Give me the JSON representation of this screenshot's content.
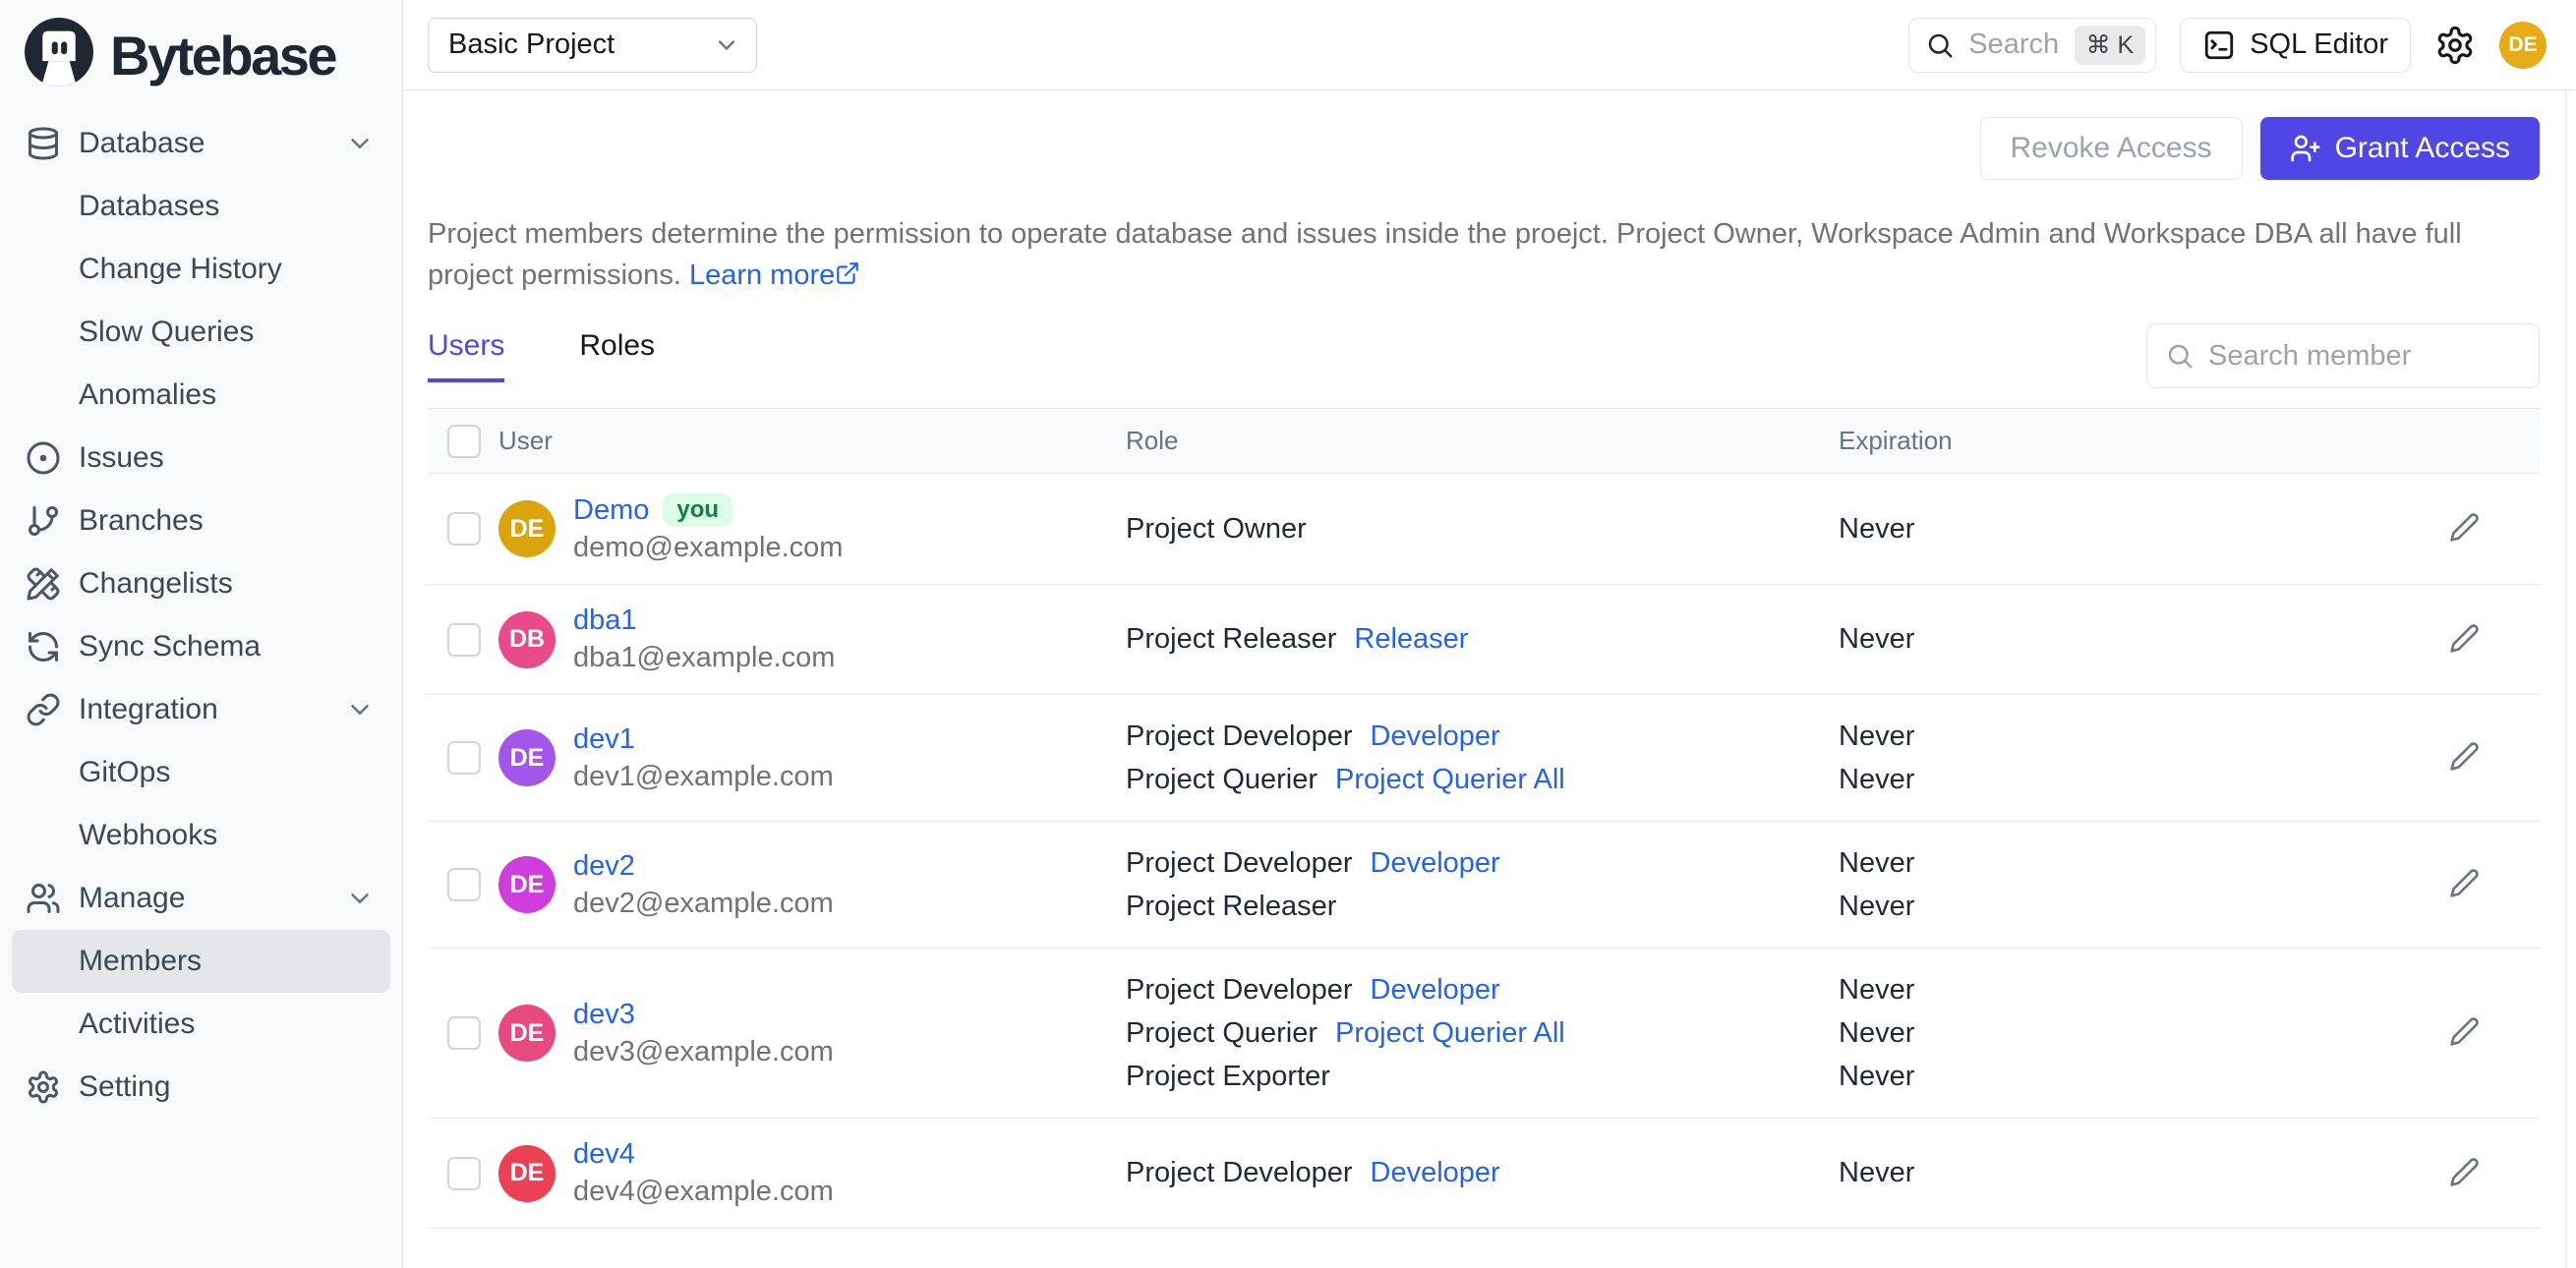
{
  "brand": {
    "name": "Bytebase"
  },
  "topbar": {
    "project_selector": {
      "value": "Basic Project"
    },
    "search": {
      "placeholder": "Search",
      "shortcut": "⌘ K"
    },
    "sql_editor": {
      "label": "SQL Editor"
    },
    "avatar": {
      "initials": "DE",
      "color": "#e7ab18"
    }
  },
  "sidebar": {
    "items": [
      {
        "label": "Database",
        "icon": "database",
        "kind": "group",
        "chevron": true
      },
      {
        "label": "Databases",
        "kind": "sub"
      },
      {
        "label": "Change History",
        "kind": "sub"
      },
      {
        "label": "Slow Queries",
        "kind": "sub"
      },
      {
        "label": "Anomalies",
        "kind": "sub"
      },
      {
        "label": "Issues",
        "icon": "issues",
        "kind": "group"
      },
      {
        "label": "Branches",
        "icon": "branch",
        "kind": "group"
      },
      {
        "label": "Changelists",
        "icon": "changelist",
        "kind": "group"
      },
      {
        "label": "Sync Schema",
        "icon": "sync",
        "kind": "group"
      },
      {
        "label": "Integration",
        "icon": "link",
        "kind": "group",
        "chevron": true
      },
      {
        "label": "GitOps",
        "kind": "sub"
      },
      {
        "label": "Webhooks",
        "kind": "sub"
      },
      {
        "label": "Manage",
        "icon": "users",
        "kind": "group",
        "chevron": true
      },
      {
        "label": "Members",
        "kind": "sub",
        "active": true
      },
      {
        "label": "Activities",
        "kind": "sub"
      },
      {
        "label": "Setting",
        "icon": "gear",
        "kind": "group"
      }
    ]
  },
  "page": {
    "actions": {
      "revoke_label": "Revoke Access",
      "grant_label": "Grant Access"
    },
    "description": {
      "text": "Project members determine the permission to operate database and issues inside the proejct. Project Owner, Workspace Admin and Workspace DBA all have full project permissions.",
      "learn_more": "Learn more"
    },
    "tabs": [
      {
        "label": "Users",
        "active": true
      },
      {
        "label": "Roles",
        "active": false
      }
    ],
    "member_search": {
      "placeholder": "Search member"
    }
  },
  "members_table": {
    "columns": {
      "user": "User",
      "role": "Role",
      "expiration": "Expiration"
    },
    "rows": [
      {
        "initials": "DE",
        "color": "#d9a40e",
        "name": "Demo",
        "badge": "you",
        "email": "demo@example.com",
        "roles": [
          {
            "name": "Project Owner",
            "link": "",
            "expiration": "Never"
          }
        ]
      },
      {
        "initials": "DB",
        "color": "#ea4a8b",
        "name": "dba1",
        "email": "dba1@example.com",
        "roles": [
          {
            "name": "Project Releaser",
            "link": "Releaser",
            "expiration": "Never"
          }
        ]
      },
      {
        "initials": "DE",
        "color": "#a357ea",
        "name": "dev1",
        "email": "dev1@example.com",
        "roles": [
          {
            "name": "Project Developer",
            "link": "Developer",
            "expiration": "Never"
          },
          {
            "name": "Project Querier",
            "link": "Project Querier All",
            "expiration": "Never"
          }
        ]
      },
      {
        "initials": "DE",
        "color": "#d03ddd",
        "name": "dev2",
        "email": "dev2@example.com",
        "roles": [
          {
            "name": "Project Developer",
            "link": "Developer",
            "expiration": "Never"
          },
          {
            "name": "Project Releaser",
            "link": "",
            "expiration": "Never"
          }
        ]
      },
      {
        "initials": "DE",
        "color": "#e84980",
        "name": "dev3",
        "email": "dev3@example.com",
        "roles": [
          {
            "name": "Project Developer",
            "link": "Developer",
            "expiration": "Never"
          },
          {
            "name": "Project Querier",
            "link": "Project Querier All",
            "expiration": "Never"
          },
          {
            "name": "Project Exporter",
            "link": "",
            "expiration": "Never"
          }
        ]
      },
      {
        "initials": "DE",
        "color": "#ec4055",
        "name": "dev4",
        "email": "dev4@example.com",
        "roles": [
          {
            "name": "Project Developer",
            "link": "Developer",
            "expiration": "Never"
          }
        ]
      }
    ]
  },
  "colors": {
    "accent": "#4f46e5",
    "link": "#2563eb"
  }
}
